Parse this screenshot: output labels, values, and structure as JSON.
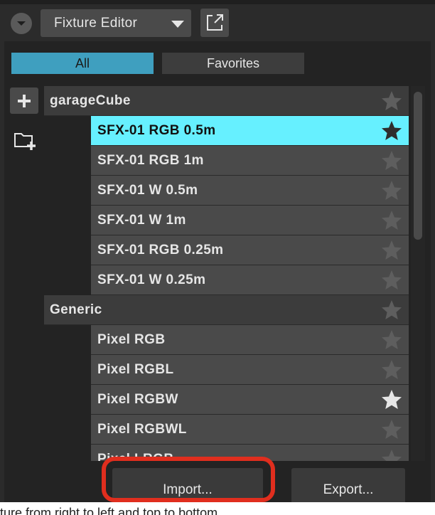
{
  "header": {
    "dropdown_label": "Fixture Editor"
  },
  "tabs": [
    {
      "label": "All",
      "active": true
    },
    {
      "label": "Favorites",
      "active": false
    }
  ],
  "groups": [
    {
      "name": "garageCube",
      "favorite": false,
      "items": [
        {
          "name": "SFX-01 RGB 0.5m",
          "favorite": true,
          "selected": true
        },
        {
          "name": "SFX-01 RGB 1m",
          "favorite": false,
          "selected": false
        },
        {
          "name": "SFX-01 W 0.5m",
          "favorite": false,
          "selected": false
        },
        {
          "name": "SFX-01 W 1m",
          "favorite": false,
          "selected": false
        },
        {
          "name": "SFX-01 RGB 0.25m",
          "favorite": false,
          "selected": false
        },
        {
          "name": "SFX-01 W 0.25m",
          "favorite": false,
          "selected": false
        }
      ]
    },
    {
      "name": "Generic",
      "favorite": false,
      "items": [
        {
          "name": "Pixel RGB",
          "favorite": false,
          "selected": false
        },
        {
          "name": "Pixel RGBL",
          "favorite": false,
          "selected": false
        },
        {
          "name": "Pixel RGBW",
          "favorite": true,
          "selected": false
        },
        {
          "name": "Pixel RGBWL",
          "favorite": false,
          "selected": false
        },
        {
          "name": "Pixel LRGB",
          "favorite": false,
          "selected": false
        }
      ]
    }
  ],
  "buttons": {
    "import_label": "Import...",
    "export_label": "Export..."
  },
  "footer": {
    "text": "ture from right to left and top to bottom"
  },
  "colors": {
    "selected_row": "#66f0ff",
    "active_tab": "#3f9fbf",
    "highlight_outline": "#e02e1e"
  },
  "icons": [
    "chevron-down-icon",
    "caret-down-icon",
    "popout-icon",
    "plus-icon",
    "folder-add-icon",
    "star-icon"
  ]
}
